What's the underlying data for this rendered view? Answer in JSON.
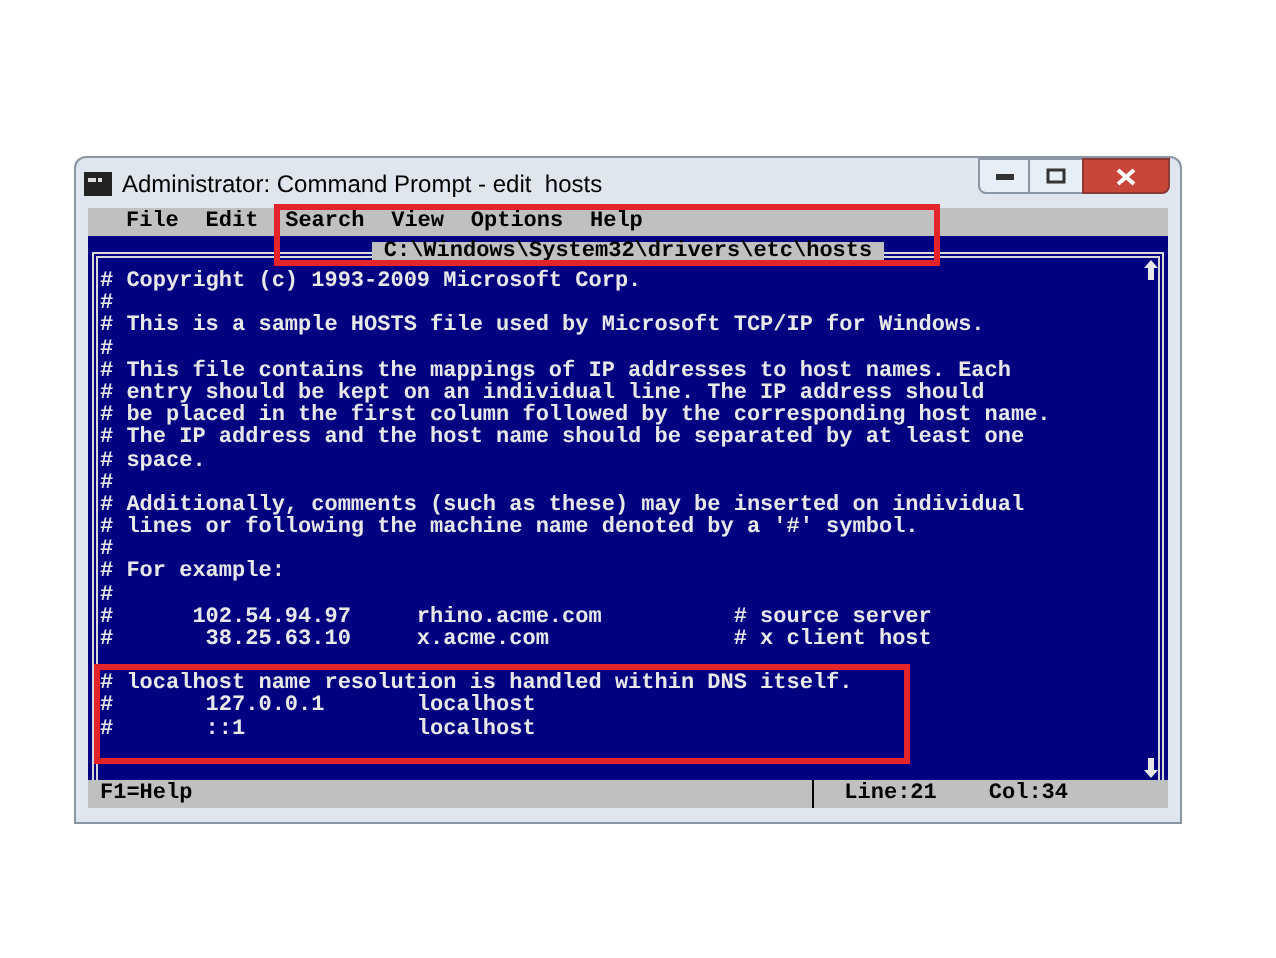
{
  "window": {
    "title": "Administrator: Command Prompt - edit  hosts"
  },
  "menu": [
    "File",
    "Edit",
    "Search",
    "View",
    "Options",
    "Help"
  ],
  "menu_highlighted": true,
  "file_path": "C:\\Windows\\System32\\drivers\\etc\\hosts",
  "lines": [
    {
      "text": "# Copyright (c) 1993-2009 Microsoft Corp.",
      "highlighted": false
    },
    {
      "text": "#",
      "highlighted": false
    },
    {
      "text": "# This is a sample HOSTS file used by Microsoft TCP/IP for Windows.",
      "highlighted": false
    },
    {
      "text": "#",
      "highlighted": false
    },
    {
      "text": "# This file contains the mappings of IP addresses to host names. Each",
      "highlighted": false
    },
    {
      "text": "# entry should be kept on an individual line. The IP address should",
      "highlighted": false
    },
    {
      "text": "# be placed in the first column followed by the corresponding host name.",
      "highlighted": false
    },
    {
      "text": "# The IP address and the host name should be separated by at least one",
      "highlighted": false
    },
    {
      "text": "# space.",
      "highlighted": false
    },
    {
      "text": "#",
      "highlighted": false
    },
    {
      "text": "# Additionally, comments (such as these) may be inserted on individual",
      "highlighted": false
    },
    {
      "text": "# lines or following the machine name denoted by a '#' symbol.",
      "highlighted": false
    },
    {
      "text": "#",
      "highlighted": false
    },
    {
      "text": "# For example:",
      "highlighted": false
    },
    {
      "text": "#",
      "highlighted": false
    },
    {
      "text": "#      102.54.94.97     rhino.acme.com          # source server",
      "highlighted": false
    },
    {
      "text": "#       38.25.63.10     x.acme.com              # x client host",
      "highlighted": false
    },
    {
      "text": "# localhost name resolution is handled within DNS itself.",
      "highlighted": true
    },
    {
      "text": "#       127.0.0.1       localhost",
      "highlighted": true
    },
    {
      "text": "#       ::1             localhost",
      "highlighted": true
    }
  ],
  "status_bar": {
    "help": "F1=Help",
    "line": "Line:21",
    "column": "Col:34"
  }
}
